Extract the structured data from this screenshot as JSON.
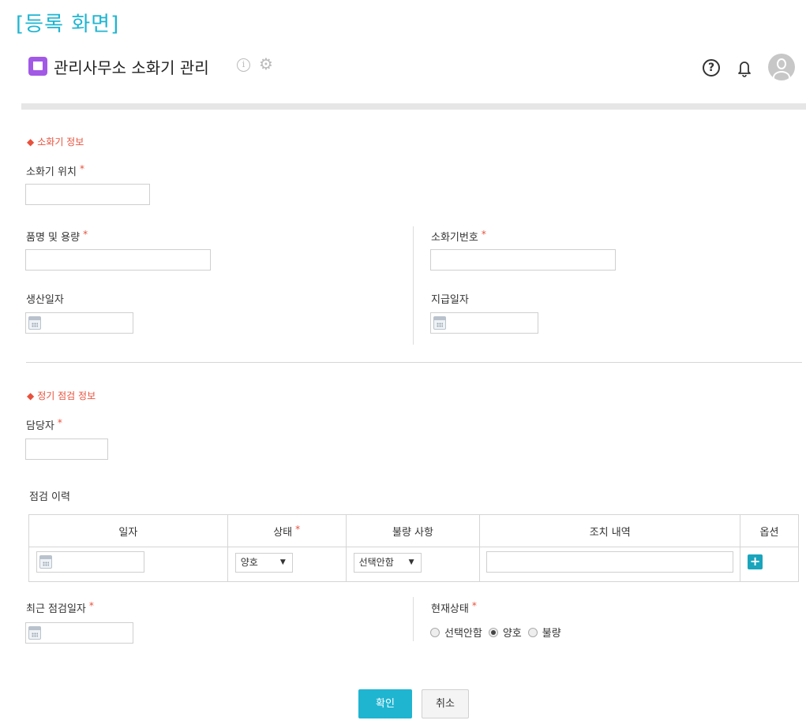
{
  "caption": "[등록 화면]",
  "header": {
    "title": "관리사무소 소화기 관리",
    "info_glyph": "i",
    "gear_glyph": "⚙",
    "help_glyph": "?"
  },
  "section1": {
    "title": "소화기 정보",
    "marker": "◆",
    "location_label": "소화기 위치",
    "product_label": "품명 및 용량",
    "extinguisher_no_label": "소화기번호",
    "production_date_label": "생산일자",
    "issue_date_label": "지급일자"
  },
  "section2": {
    "title": "정기 점검 정보",
    "marker": "◆",
    "manager_label": "담당자",
    "history_label": "점검 이력"
  },
  "table": {
    "headers": [
      "일자",
      "상태",
      "불량 사항",
      "조치 내역",
      "옵션"
    ],
    "status_value": "양호",
    "defect_value": "선택안함",
    "add_glyph": "+"
  },
  "recent_date_label": "최근 점검일자",
  "current_status": {
    "label": "현재상태",
    "options": [
      "선택안함",
      "양호",
      "불량"
    ],
    "selected": "양호"
  },
  "required_mark": "*",
  "select_arrow": "▼",
  "buttons": {
    "confirm": "확인",
    "cancel": "취소"
  },
  "colors": {
    "accent": "#1fb5d1",
    "required": "#e8513c",
    "app_icon": "#a259e6"
  }
}
